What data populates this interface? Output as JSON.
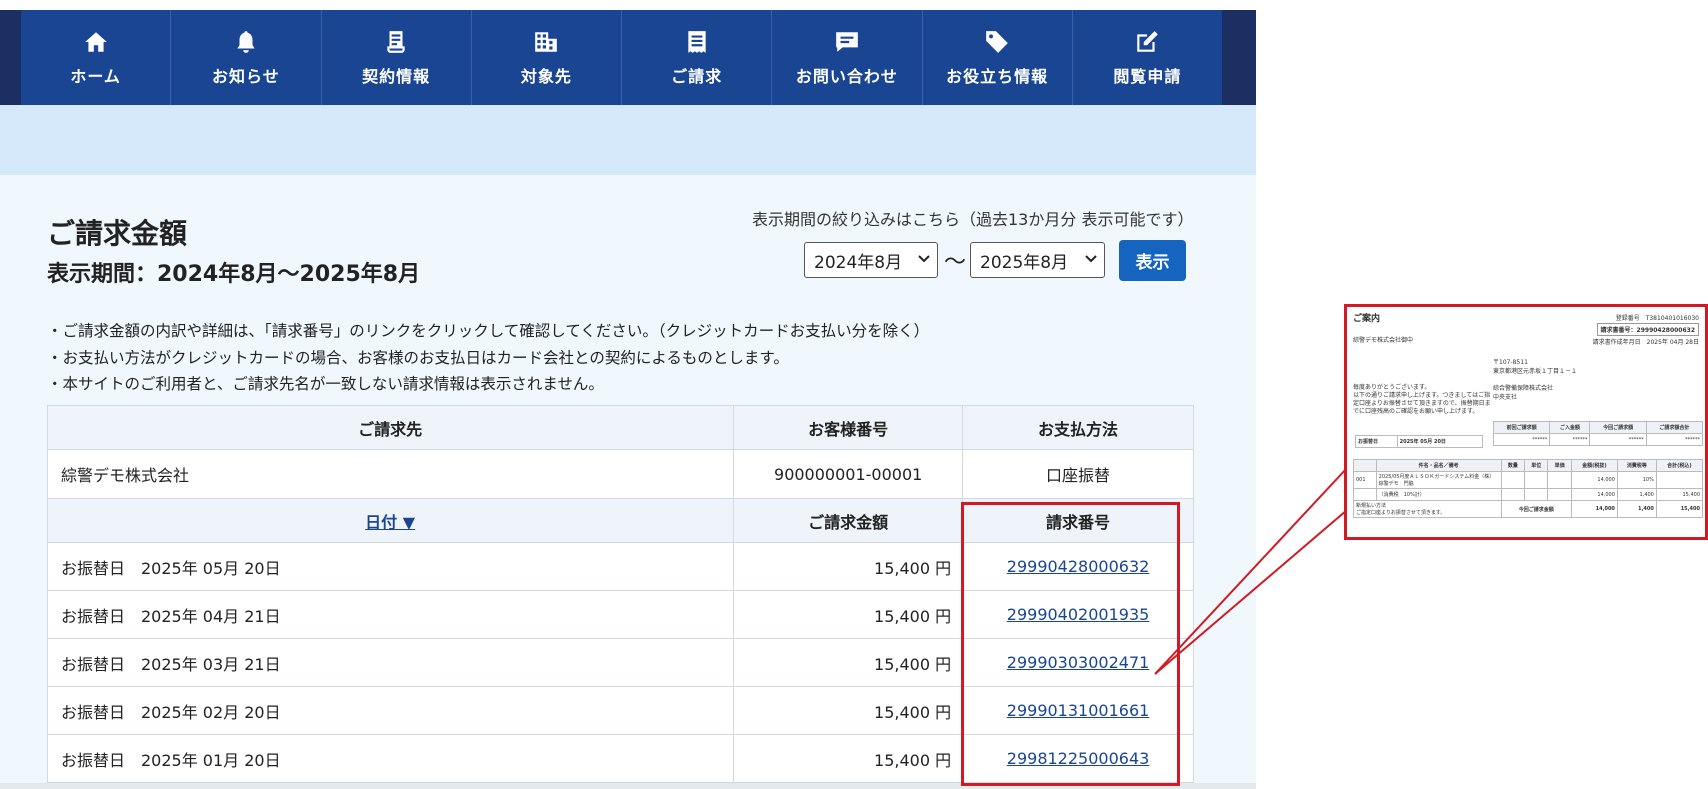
{
  "nav": {
    "items": [
      {
        "label": "ホーム",
        "icon": "home-icon"
      },
      {
        "label": "お知らせ",
        "icon": "bell-icon"
      },
      {
        "label": "契約情報",
        "icon": "contract-icon"
      },
      {
        "label": "対象先",
        "icon": "building-icon"
      },
      {
        "label": "ご請求",
        "icon": "invoice-icon"
      },
      {
        "label": "お問い合わせ",
        "icon": "chat-icon"
      },
      {
        "label": "お役立ち情報",
        "icon": "tag-icon"
      },
      {
        "label": "閲覧申請",
        "icon": "edit-icon"
      }
    ]
  },
  "header": {
    "title": "ご請求金額",
    "period": "表示期間：2024年8月〜2025年8月"
  },
  "filter": {
    "hint": "表示期間の絞り込みはこちら（過去13か月分 表示可能です）",
    "from": "2024年8月",
    "separator": "〜",
    "to": "2025年8月",
    "button": "表示"
  },
  "notes": [
    "・ご請求金額の内訳や詳細は、「請求番号」のリンクをクリックして確認してください。（クレジットカードお支払い分を除く）",
    "・お支払い方法がクレジットカードの場合、お客様のお支払日はカード会社との契約によるものとします。",
    "・本サイトのご利用者と、ご請求先名が一致しない請求情報は表示されません。"
  ],
  "table": {
    "headers": {
      "billing_to": "ご請求先",
      "customer_no": "お客様番号",
      "payment_method": "お支払方法"
    },
    "customer": {
      "billing_to": "綜警デモ株式会社",
      "customer_no": "900000001-00001",
      "payment_method": "口座振替"
    },
    "sub_headers": {
      "date": "日付 ▼",
      "amount": "ご請求金額",
      "invoice_no": "請求番号"
    },
    "rows": [
      {
        "date": "お振替日　2025年 05月 20日",
        "amount": "15,400 円",
        "invoice_no": "29990428000632"
      },
      {
        "date": "お振替日　2025年 04月 21日",
        "amount": "15,400 円",
        "invoice_no": "29990402001935"
      },
      {
        "date": "お振替日　2025年 03月 21日",
        "amount": "15,400 円",
        "invoice_no": "29990303002471"
      },
      {
        "date": "お振替日　2025年 02月 20日",
        "amount": "15,400 円",
        "invoice_no": "29990131001661"
      },
      {
        "date": "お振替日　2025年 01月 20日",
        "amount": "15,400 円",
        "invoice_no": "29981225000643"
      }
    ]
  },
  "preview": {
    "title": "ご案内",
    "reg_no": "登録番号　T3810401016030",
    "invoice_no": "請求書番号：29990428000632",
    "issue_date": "請求書作成年月日　2025年 04月 28日",
    "addressee": "綜警デモ株式会社御中",
    "postal": "〒107-8511",
    "address": "東京都港区元赤坂１丁目１－１",
    "company": "綜合警備保障株式会社",
    "branch": "中央支社",
    "msg1": "毎度ありがとうございます。",
    "msg2": "以下の通りご請求申し上げます。つきましてはご指",
    "msg3": "定口座よりお振替させて頂きますので、振替期日ま",
    "msg4": "でに口座残高のご確認をお願い申し上げます。",
    "summary_headers": [
      "前回ご請求額",
      "ご入金額",
      "今回ご請求額",
      "ご請求額合計"
    ],
    "summary_values": [
      "******",
      "******",
      "******",
      "******"
    ],
    "transfer_label": "お振替日",
    "transfer_date": "2025年 05月 20日",
    "detail_headers": [
      "",
      "件名・品名／備考",
      "数量",
      "単位",
      "単価",
      "金額(税抜)",
      "消費税等",
      "合計(税込)"
    ],
    "detail_row1": [
      "001",
      "2025/05月度ＡＬＳＯＫガードシステム料金（株）綜警デモ　門脇",
      "",
      "",
      "",
      "14,000",
      "10%",
      ""
    ],
    "detail_row2": [
      "",
      "（消費税　10%計）",
      "",
      "",
      "",
      "14,000",
      "1,400",
      "15,400"
    ],
    "footer_note1": "新規払い方法",
    "footer_note2": "ご指定口座よりお振替させて頂きます。",
    "total_label": "今回ご請求金額",
    "total_values": [
      "14,000",
      "1,400",
      "15,400"
    ]
  }
}
